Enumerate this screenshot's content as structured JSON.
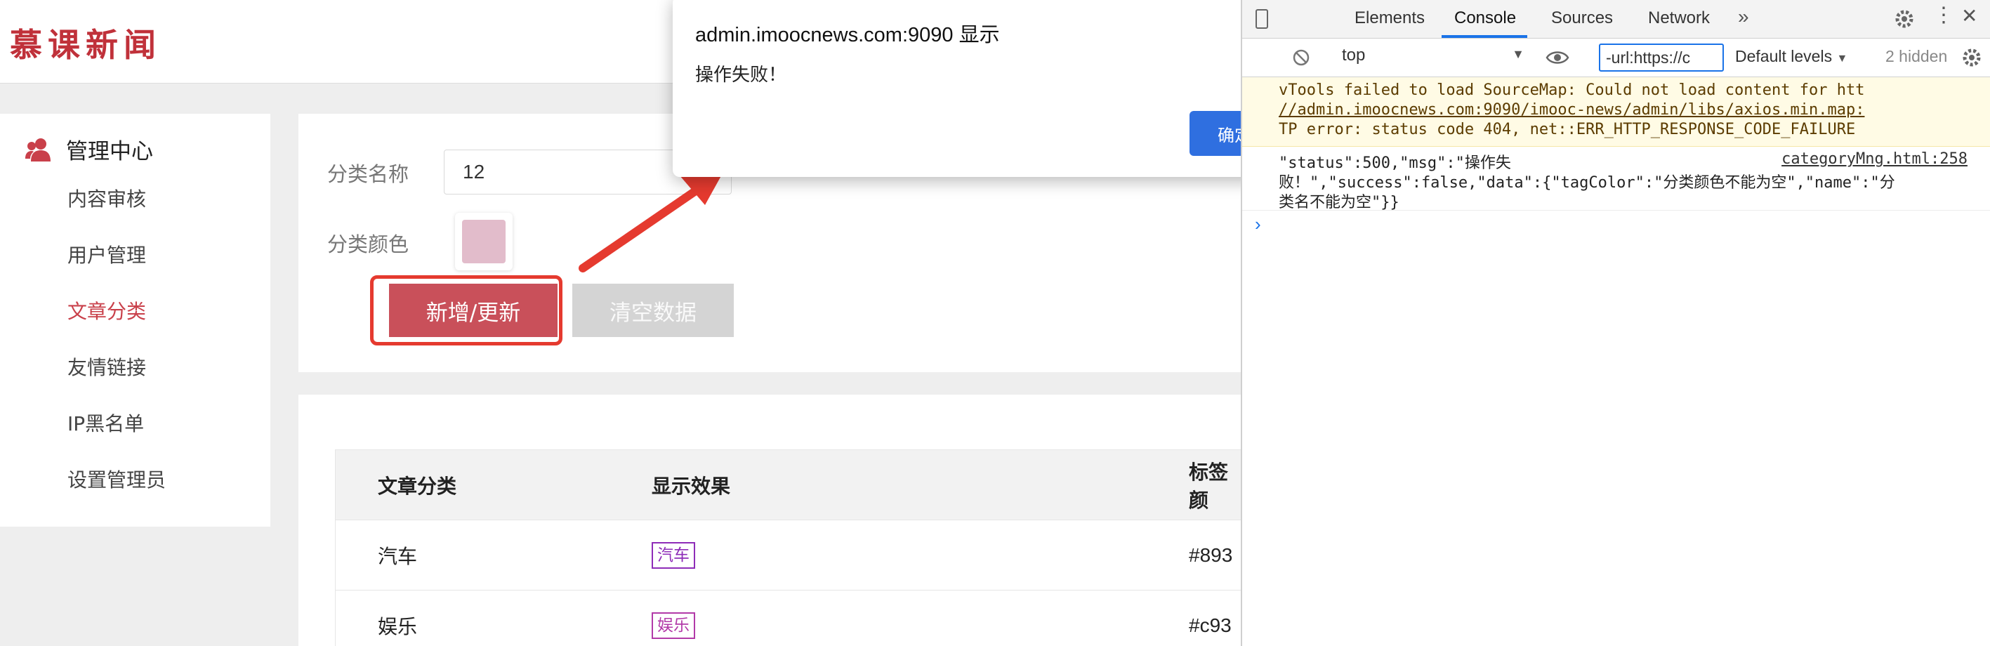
{
  "app": {
    "logo": "慕课新闻",
    "sidebar": {
      "title": "管理中心",
      "items": [
        {
          "label": "内容审核"
        },
        {
          "label": "用户管理"
        },
        {
          "label": "文章分类",
          "active": true
        },
        {
          "label": "友情链接"
        },
        {
          "label": "IP黑名单"
        },
        {
          "label": "设置管理员"
        }
      ]
    },
    "form": {
      "name_label": "分类名称",
      "name_value": "12",
      "color_label": "分类颜色",
      "color_value": "#e2bccb",
      "submit_label": "新增/更新",
      "clear_label": "清空数据"
    },
    "table": {
      "headers": [
        "文章分类",
        "显示效果",
        "标签颜"
      ],
      "rows": [
        {
          "name": "汽车",
          "tag": "汽车",
          "color": "#893"
        },
        {
          "name": "娱乐",
          "tag": "娱乐",
          "color": "#c93"
        }
      ]
    }
  },
  "dialog": {
    "title": "admin.imoocnews.com:9090 显示",
    "message": "操作失败！",
    "ok_label": "确定"
  },
  "devtools": {
    "tabs": [
      "Elements",
      "Console",
      "Sources",
      "Network"
    ],
    "active_tab": "Console",
    "context": "top",
    "filter": "-url:https://c",
    "levels": "Default levels",
    "hidden": "2 hidden",
    "warning_lines": [
      "vTools failed to load SourceMap: Could not load content for htt",
      "//admin.imoocnews.com:9090/imooc-news/admin/libs/axios.min.map:",
      "TP error: status code 404, net::ERR_HTTP_RESPONSE_CODE_FAILURE"
    ],
    "log_lines": [
      "\"status\":500,\"msg\":\"操作失",
      "败！\",\"success\":false,\"data\":{\"tagColor\":\"分类颜色不能为空\",\"name\":\"分",
      "类名不能为空\"}}"
    ],
    "log_source": "categoryMng.html:258"
  },
  "colors": {
    "brand": "#c0313a",
    "active_nav": "#c9404a",
    "primary_button": "#c9505a",
    "highlight": "#e53a2f",
    "dialog_button": "#2f6fe0",
    "tag": "#8e2cb8"
  }
}
